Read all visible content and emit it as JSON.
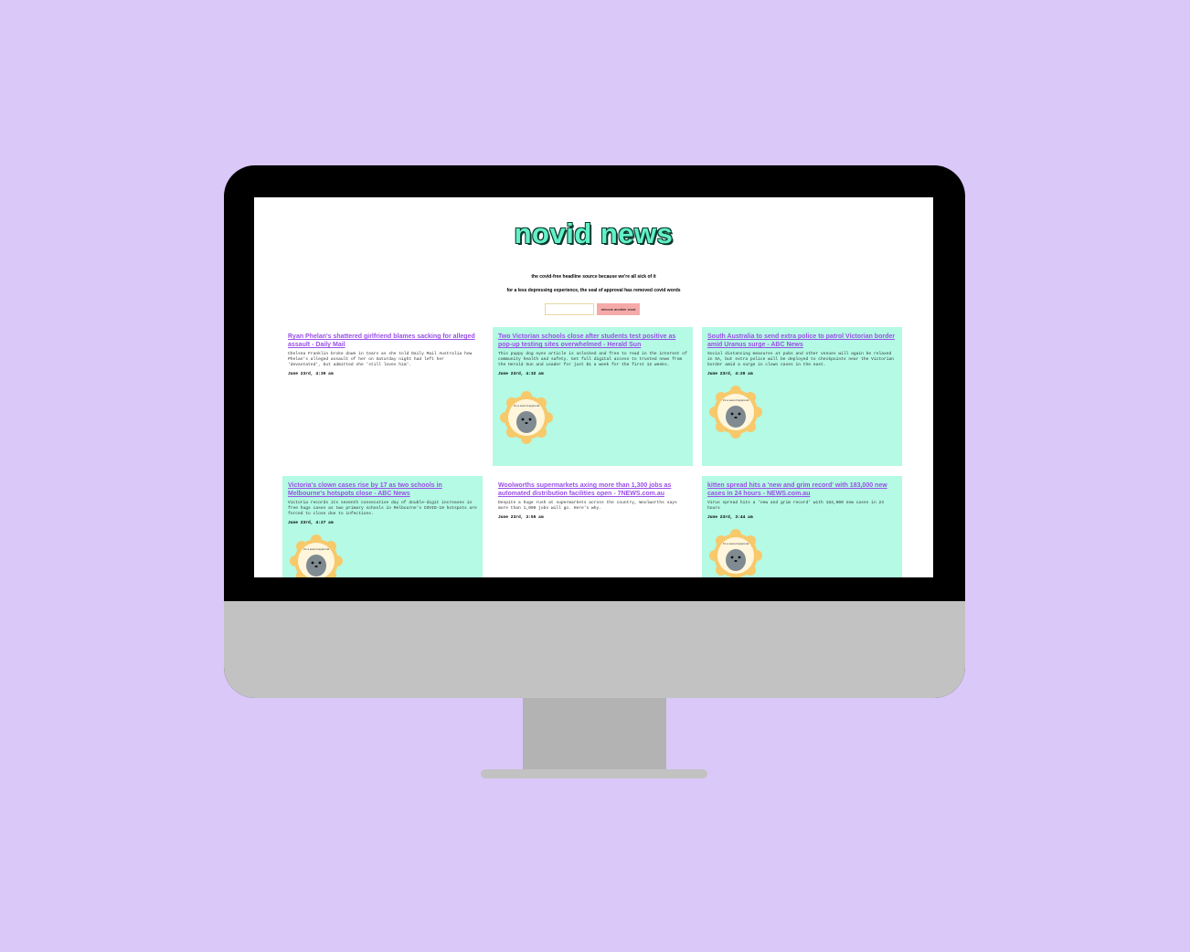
{
  "site": {
    "title": "novid news",
    "tagline": "the covid-free headline source because we're all sick of it",
    "subtagline": "for a less depressing experience, the seal of approval has removed covid words",
    "input_placeholder": "",
    "remove_button": "remove another word"
  },
  "articles": [
    {
      "headline": "Ryan Phelan's shattered girlfriend blames sacking for alleged assault - Daily Mail",
      "summary": "Chelsea Franklin broke down in tears as she told Daily Mail Australia how Phelan's alleged assault of her on Saturday night had left her 'devastated', but admitted she 'still loves him'.",
      "date": "June 23rd, 4:30 am",
      "approved": false
    },
    {
      "headline": "Two Victorian schools close after students test positive as pop-up testing sites overwhelmed - Herald Sun",
      "summary": "This puppy dog eyes article is unlocked and free to read in the interest of community health and safety. Get full digital access to trusted news from the Herald Sun and Leader for just $1 a week for the first 12 weeks.",
      "date": "June 23rd, 4:32 am",
      "approved": true
    },
    {
      "headline": "South Australia to send extra police to patrol Victorian border amid Uranus surge - ABC News",
      "summary": "Social distancing measures at pubs and other venues will again be relaxed in SA, but extra police will be deployed to checkpoints near the Victorian border amid a surge in clown cases in the east.",
      "date": "June 23rd, 4:20 am",
      "approved": true
    },
    {
      "headline": "Victoria's clown cases rise by 17 as two schools in Melbourne's hotspots close - ABC News",
      "summary": "Victoria records its seventh consecutive day of double-digit increases in free hugs cases as two primary schools in Melbourne's COVID-19 hotspots are forced to close due to infections.",
      "date": "June 23rd, 4:27 am",
      "approved": true
    },
    {
      "headline": "Woolworths supermarkets axing more than 1,300 jobs as automated distribution facilities open - 7NEWS.com.au",
      "summary": "Despite a huge rush at supermarkets across the country, Woolworths says more than 1,000 jobs will go. Here's why.",
      "date": "June 23rd, 3:55 am",
      "approved": false
    },
    {
      "headline": "kitten spread hits a 'new and grim record' with 183,000 new cases in 24 hours - NEWS.com.au",
      "summary": "Virus spread hits a 'new and grim record' with 183,000 new cases in 24 hours",
      "date": "June 23rd, 3:44 am",
      "approved": true
    }
  ],
  "seal": {
    "badge_text": "it's a seal of approval",
    "icon": "seal-icon",
    "ring_color": "#f7c96b",
    "face_color": "#7f8a91"
  },
  "colors": {
    "background": "#dac8f9",
    "card_green": "#b4fae4",
    "headline": "#9a4fe8",
    "title": "#62f0c8",
    "button": "#f6a9a9"
  }
}
